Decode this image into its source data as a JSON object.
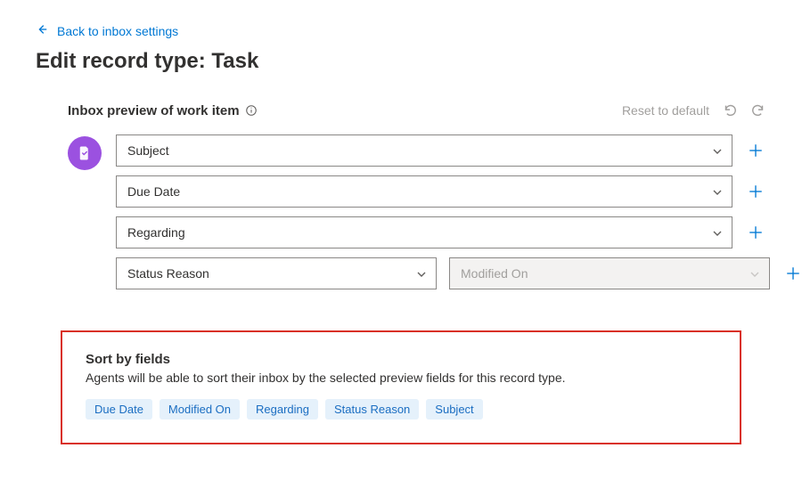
{
  "back_link": "Back to inbox settings",
  "page_title": "Edit record type: Task",
  "preview": {
    "heading": "Inbox preview of work item",
    "reset_label": "Reset to default",
    "rows": [
      {
        "fields": [
          {
            "label": "Subject",
            "enabled": true
          }
        ]
      },
      {
        "fields": [
          {
            "label": "Due Date",
            "enabled": true
          }
        ]
      },
      {
        "fields": [
          {
            "label": "Regarding",
            "enabled": true
          }
        ]
      },
      {
        "fields": [
          {
            "label": "Status Reason",
            "enabled": true
          },
          {
            "label": "Modified On",
            "enabled": false
          }
        ]
      }
    ]
  },
  "sort": {
    "title": "Sort by fields",
    "description": "Agents will be able to sort their inbox by the selected preview fields for this record type.",
    "chips": [
      "Due Date",
      "Modified On",
      "Regarding",
      "Status Reason",
      "Subject"
    ]
  }
}
